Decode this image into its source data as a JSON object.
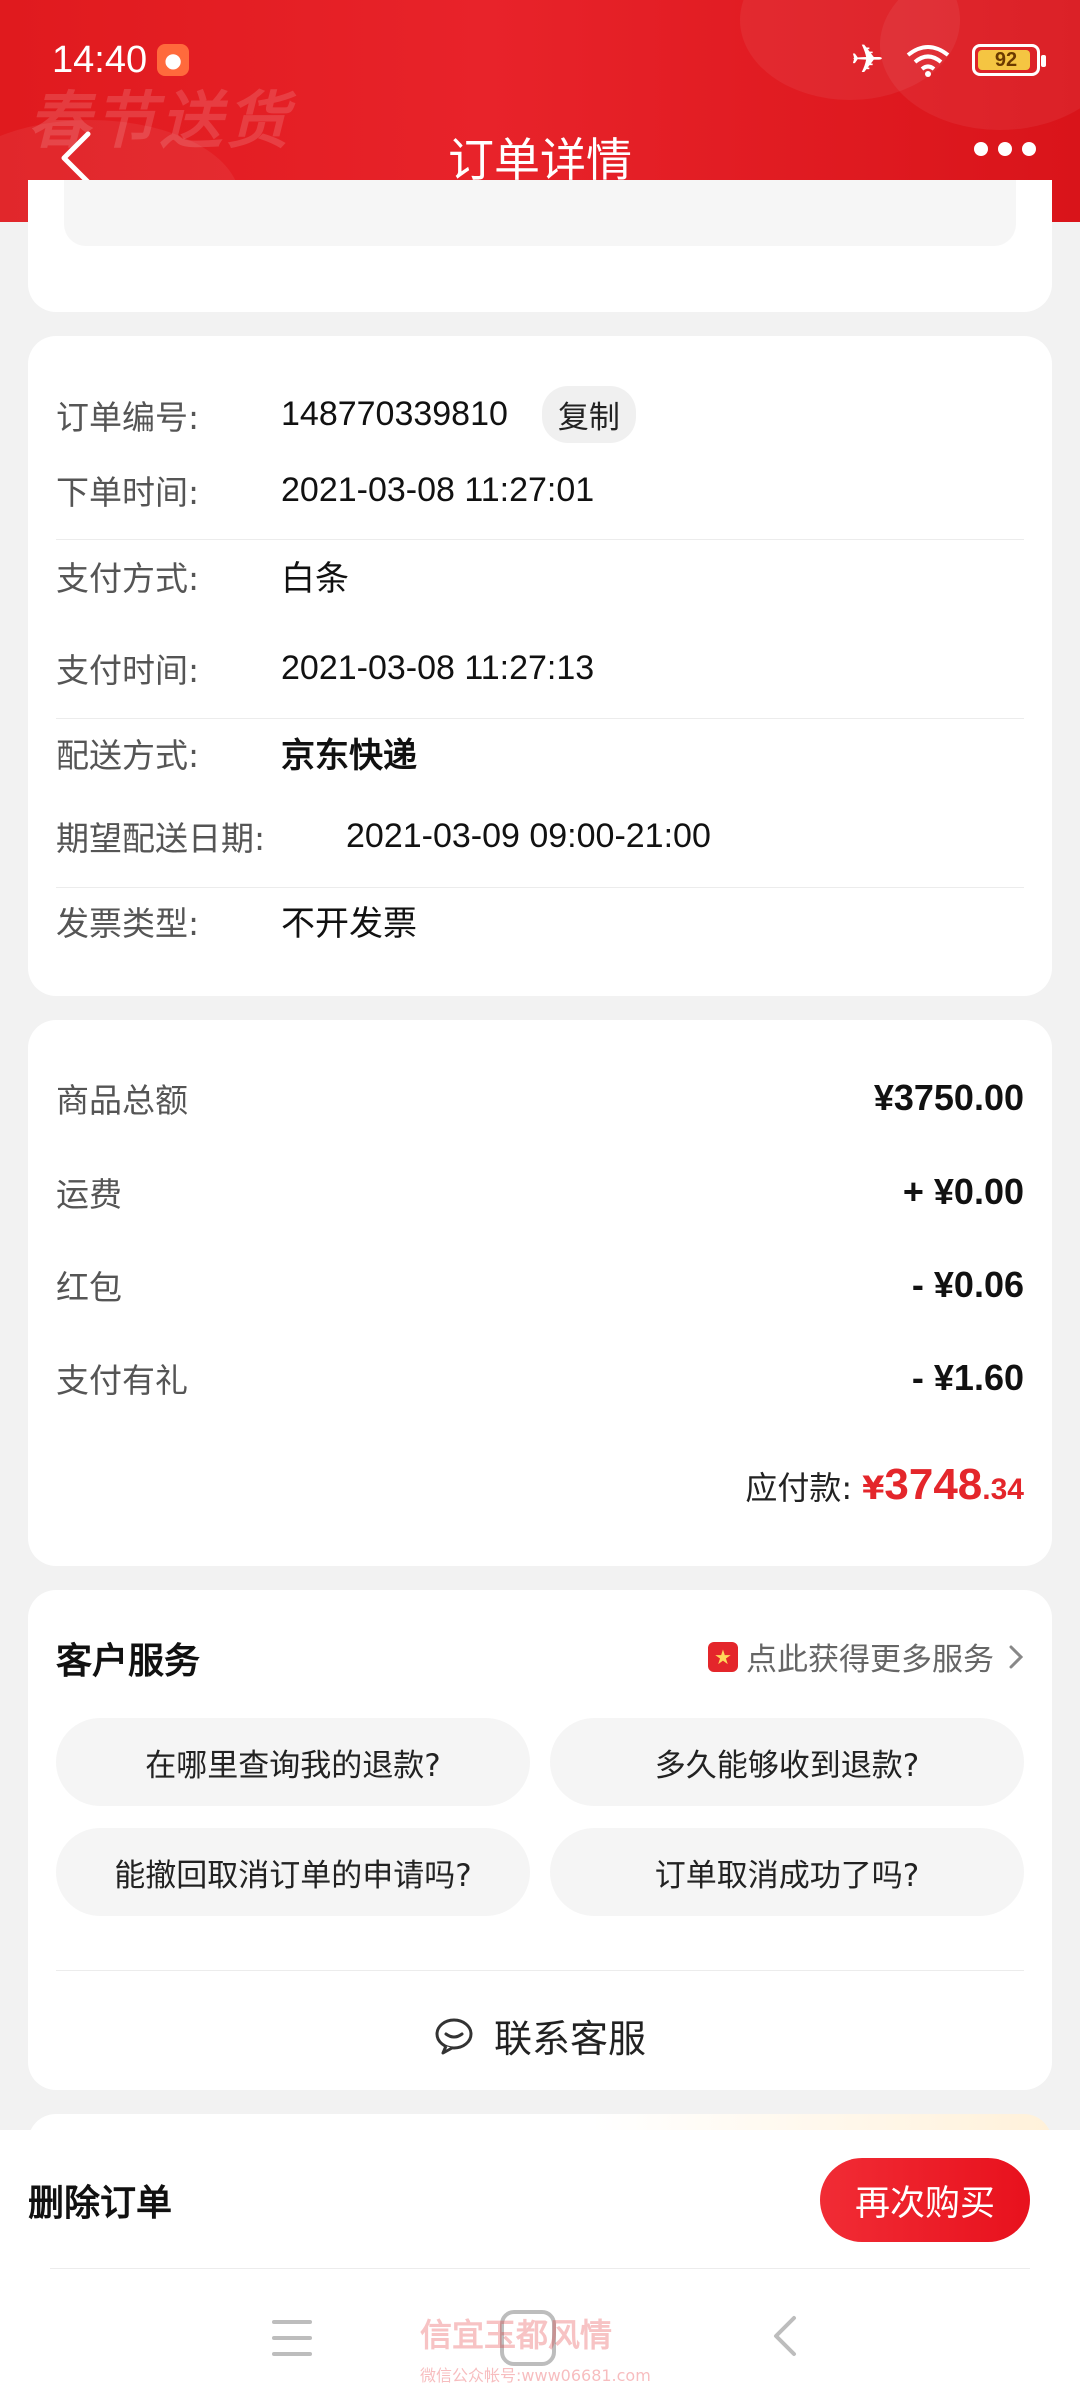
{
  "status_bar": {
    "time": "14:40",
    "battery": "92",
    "battery_level": 0.92
  },
  "header": {
    "title": "订单详情",
    "deco_text": "春节送货"
  },
  "order_info": {
    "order_no_label": "订单编号:",
    "order_no": "148770339810",
    "copy_label": "复制",
    "order_time_label": "下单时间:",
    "order_time": "2021-03-08 11:27:01",
    "pay_method_label": "支付方式:",
    "pay_method": "白条",
    "pay_time_label": "支付时间:",
    "pay_time": "2021-03-08 11:27:13",
    "delivery_label": "配送方式:",
    "delivery": "京东快递",
    "expected_label": "期望配送日期:",
    "expected": "2021-03-09 09:00-21:00",
    "invoice_label": "发票类型:",
    "invoice": "不开发票"
  },
  "price": {
    "items": [
      {
        "label": "商品总额",
        "value": "¥3750.00"
      },
      {
        "label": "运费",
        "value": "+ ¥0.00"
      },
      {
        "label": "红包",
        "value": "- ¥0.06"
      },
      {
        "label": "支付有礼",
        "value": "- ¥1.60"
      }
    ],
    "total_label": "应付款:",
    "total_currency": "¥",
    "total_int": "3748",
    "total_dec": ".34"
  },
  "customer_service": {
    "title": "客户服务",
    "more_label": "点此获得更多服务",
    "faqs": [
      "在哪里查询我的退款?",
      "多久能够收到退款?",
      "能撤回取消订单的申请吗?",
      "订单取消成功了吗?"
    ],
    "contact_label": "联系客服"
  },
  "bottom": {
    "delete_label": "删除订单",
    "buy_again_label": "再次购买"
  },
  "watermark": {
    "text": "信宜玉都风情",
    "sub": "微信公众帐号:www06681.com"
  },
  "colors": {
    "brand_red": "#e4262b",
    "header_red": "#e01a1e"
  }
}
